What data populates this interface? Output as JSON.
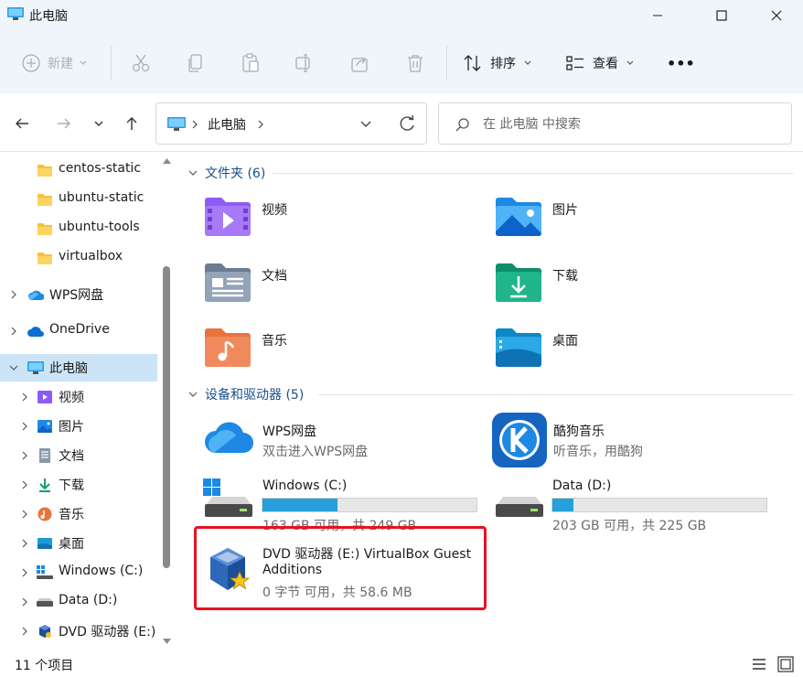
{
  "window": {
    "title": "此电脑"
  },
  "toolbar": {
    "new_label": "新建",
    "sort_label": "排序",
    "view_label": "查看",
    "more_label": "•••"
  },
  "address": {
    "crumb": "此电脑"
  },
  "search": {
    "placeholder": "在 此电脑 中搜索"
  },
  "sidebar": {
    "items": [
      {
        "label": "centos-static",
        "icon": "folder-icon"
      },
      {
        "label": "ubuntu-static",
        "icon": "folder-icon"
      },
      {
        "label": "ubuntu-tools",
        "icon": "folder-icon"
      },
      {
        "label": "virtualbox",
        "icon": "folder-icon"
      },
      {
        "label": "WPS网盘",
        "icon": "wps-cloud-icon"
      },
      {
        "label": "OneDrive",
        "icon": "onedrive-icon"
      },
      {
        "label": "此电脑",
        "icon": "computer-icon"
      },
      {
        "label": "视频",
        "icon": "videos-icon"
      },
      {
        "label": "图片",
        "icon": "pictures-icon"
      },
      {
        "label": "文档",
        "icon": "documents-icon"
      },
      {
        "label": "下载",
        "icon": "downloads-icon"
      },
      {
        "label": "音乐",
        "icon": "music-icon"
      },
      {
        "label": "桌面",
        "icon": "desktop-icon"
      },
      {
        "label": "Windows (C:)",
        "icon": "windows-drive-icon"
      },
      {
        "label": "Data (D:)",
        "icon": "drive-icon"
      },
      {
        "label": "DVD 驱动器 (E:)",
        "icon": "virtualbox-icon"
      }
    ]
  },
  "folders": {
    "header": "文件夹 (6)",
    "items": [
      {
        "label": "视频"
      },
      {
        "label": "图片"
      },
      {
        "label": "文档"
      },
      {
        "label": "下载"
      },
      {
        "label": "音乐"
      },
      {
        "label": "桌面"
      }
    ]
  },
  "devices": {
    "header": "设备和驱动器 (5)",
    "wps": {
      "name": "WPS网盘",
      "sub": "双击进入WPS网盘"
    },
    "kugou": {
      "name": "酷狗音乐",
      "sub": "听音乐，用酷狗"
    },
    "c": {
      "name": "Windows (C:)",
      "sub": "163 GB 可用，共 249 GB",
      "used_fraction": 0.35
    },
    "d": {
      "name": "Data (D:)",
      "sub": "203 GB 可用，共 225 GB",
      "used_fraction": 0.1
    },
    "e": {
      "name_line1": "DVD 驱动器 (E:) VirtualBox Guest",
      "name_line2": "Additions",
      "sub": "0 字节 可用，共 58.6 MB"
    }
  },
  "status": {
    "count": "11 个项目"
  },
  "colors": {
    "accent": "#26a0da",
    "highlight": "#e81123",
    "selected": "#cce4f7"
  }
}
